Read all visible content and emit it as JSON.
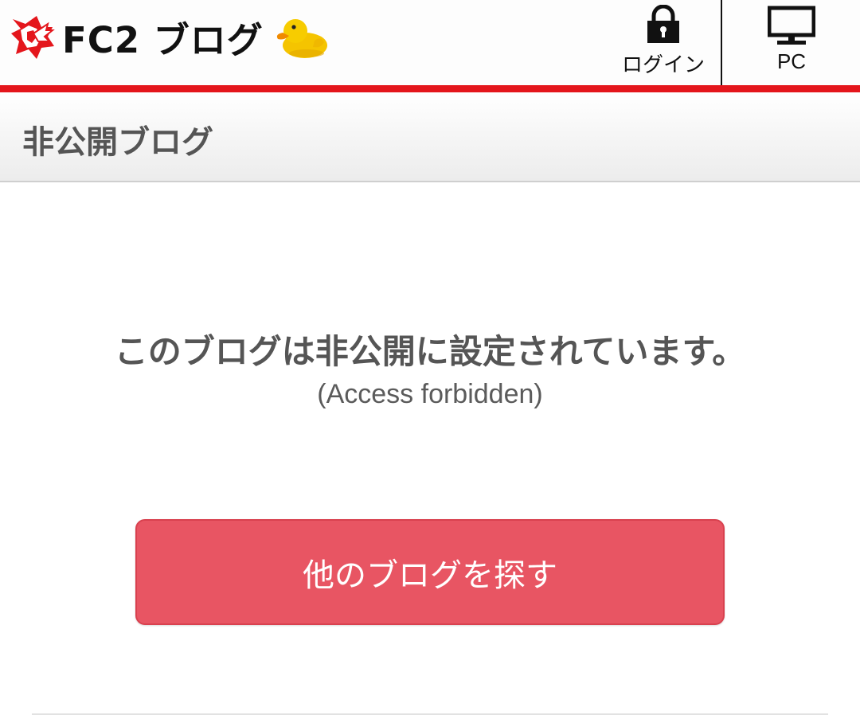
{
  "header": {
    "logo_text": "FC2 ブログ",
    "login_label": "ログイン",
    "pc_label": "PC"
  },
  "section": {
    "title": "非公開ブログ"
  },
  "message": {
    "main": "このブログは非公開に設定されています。",
    "sub": "(Access forbidden)"
  },
  "actions": {
    "search_blog_label": "他のブログを探す"
  },
  "colors": {
    "accent_red": "#e4161c",
    "button_red": "#e85563"
  },
  "icons": [
    "fc2-logo-icon",
    "duck-icon",
    "lock-icon",
    "monitor-icon"
  ]
}
